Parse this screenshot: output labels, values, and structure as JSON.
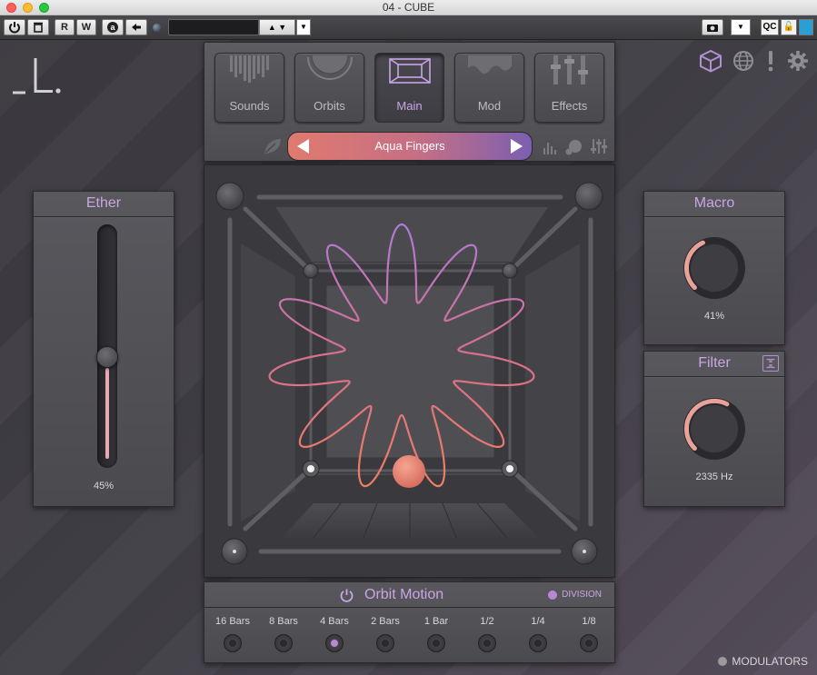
{
  "window": {
    "title": "04 - CUBE"
  },
  "hostbar": {
    "buttons": [
      "R",
      "W"
    ],
    "auto_label": "a",
    "qc_label": "QC"
  },
  "tabs": [
    {
      "label": "Sounds",
      "active": false
    },
    {
      "label": "Orbits",
      "active": false
    },
    {
      "label": "Main",
      "active": true
    },
    {
      "label": "Mod",
      "active": false
    },
    {
      "label": "Effects",
      "active": false
    }
  ],
  "preset": {
    "name": "Aqua Fingers"
  },
  "ether": {
    "title": "Ether",
    "value_text": "45%",
    "value": 0.45
  },
  "macro": {
    "title": "Macro",
    "value_text": "41%",
    "value": 0.41
  },
  "filter": {
    "title": "Filter",
    "value_text": "2335 Hz",
    "value": 0.6
  },
  "orbit_motion": {
    "title": "Orbit Motion",
    "division_label": "DIVISION",
    "divisions": [
      {
        "label": "16 Bars",
        "selected": false
      },
      {
        "label": "8 Bars",
        "selected": false
      },
      {
        "label": "4 Bars",
        "selected": true
      },
      {
        "label": "2 Bars",
        "selected": false
      },
      {
        "label": "1 Bar",
        "selected": false
      },
      {
        "label": "1/2",
        "selected": false
      },
      {
        "label": "1/4",
        "selected": false
      },
      {
        "label": "1/8",
        "selected": false
      }
    ]
  },
  "modulators_label": "MODULATORS",
  "colors": {
    "accent": "#c9a5e6",
    "preset_start": "#e07a6e",
    "preset_end": "#7b5fb0",
    "knob_arc": "#e8a29a"
  }
}
